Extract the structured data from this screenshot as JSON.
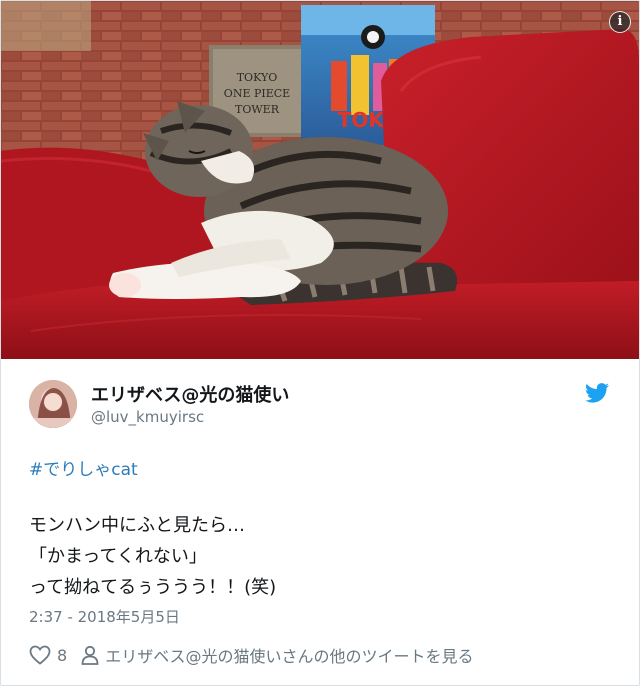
{
  "media": {
    "poster_text": "TOKYO ONE PIECE TOWER",
    "banner_text": "TOKY",
    "info_label": "i"
  },
  "user": {
    "display_name": "エリザベス@光の猫使い",
    "handle": "@luv_kmuyirsc"
  },
  "tweet": {
    "hashtag": "#でりしゃcat",
    "lines": [
      "モンハン中にふと見たら…",
      "「かまってくれない」",
      "って拗ねてるぅううう！！(笑)"
    ],
    "timestamp": "2:37 - 2018年5月5日"
  },
  "actions": {
    "like_count": "8",
    "more_tweets_label": "エリザベス@光の猫使いさんの他のツイートを見る"
  },
  "colors": {
    "link": "#2b7bb9",
    "twitter_blue": "#1da1f2",
    "secondary_text": "#697882",
    "sofa_red": "#b5161f"
  },
  "icons": [
    "info-icon",
    "twitter-bird-icon",
    "heart-icon",
    "person-icon"
  ]
}
